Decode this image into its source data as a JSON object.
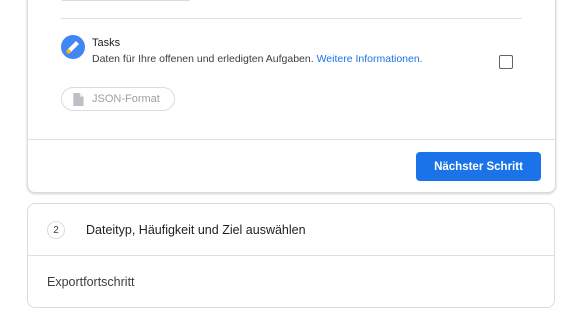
{
  "export_step": {
    "product": {
      "icon": "google-tasks-icon",
      "name": "Tasks",
      "description": "Daten für Ihre offenen und erledigten Aufgaben.",
      "more_info_link": "Weitere Informationen.",
      "included": false
    },
    "format_chip": {
      "icon": "document-icon",
      "label": "JSON-Format"
    },
    "next_button": "Nächster Schritt"
  },
  "step2": {
    "number": "2",
    "title": "Dateityp, Häufigkeit und Ziel auswählen"
  },
  "progress_section": {
    "title": "Exportfortschritt"
  },
  "colors": {
    "accent": "#1a73e8",
    "border": "#dadce0",
    "tasks_icon_blue": "#4285f4",
    "tasks_icon_yellow": "#fbbc04"
  }
}
